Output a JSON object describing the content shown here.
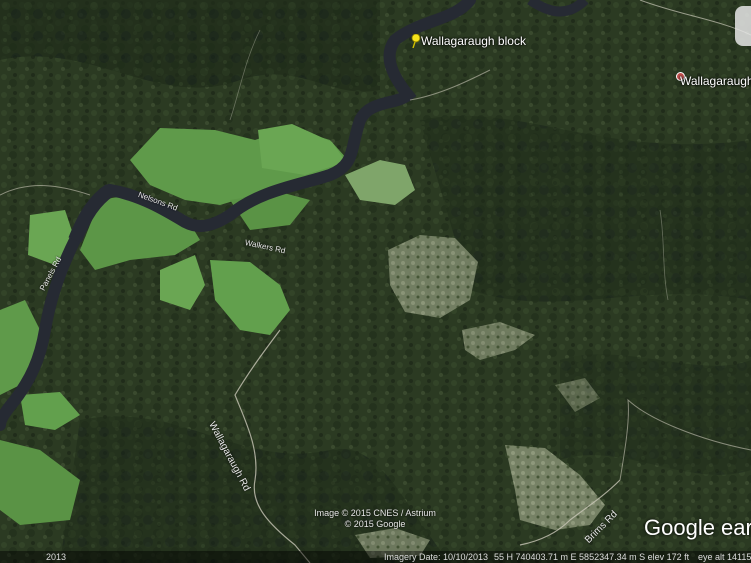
{
  "map": {
    "places": [
      {
        "name": "Wallagaraugh block",
        "marker": "yellow-pushpin-icon"
      },
      {
        "name": "Wallagaraugh",
        "marker": "place-dot-icon"
      }
    ],
    "roads": [
      {
        "name": "Wallagaraugh Rd"
      },
      {
        "name": "Brims Rd"
      },
      {
        "name": "Walkers Rd"
      },
      {
        "name": "Nelsons Rd"
      },
      {
        "name": "Panels Rd"
      }
    ],
    "colors": {
      "forest": "#2b3a22",
      "pasture": "#5f9a4a",
      "river": "#262a33",
      "clearing": "#9ea58a"
    }
  },
  "branding": {
    "logo": "Google earth",
    "attribution_line1": "Image © 2015 CNES / Astrium",
    "attribution_line2": "© 2015 Google"
  },
  "status": {
    "year_badge": "2013",
    "imagery_date": "Imagery Date: 10/10/2013",
    "coordinates": "55 H 740403.71 m E  5852347.34 m S  elev  172 ft",
    "eye_alt": "eye alt  14115"
  }
}
